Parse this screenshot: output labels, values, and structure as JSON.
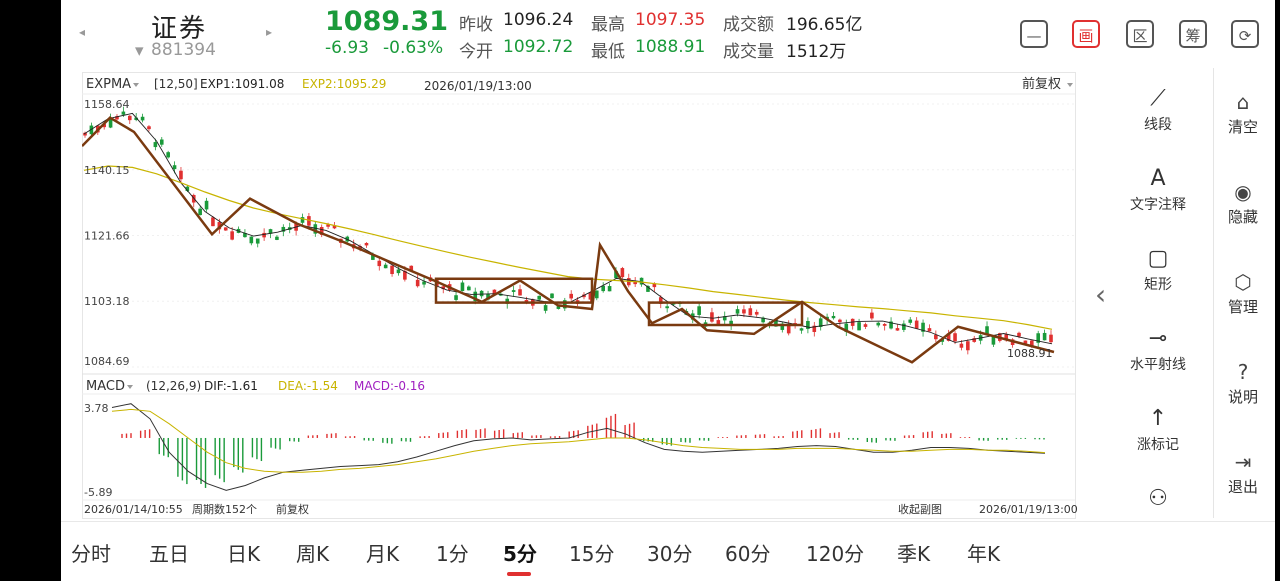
{
  "header": {
    "nav_prev": "◂",
    "nav_next": "▸",
    "name": "证券",
    "code_prefix": "▾",
    "code": "881394",
    "price": "1089.31",
    "change": "-6.93",
    "change_pct": "-0.63%",
    "stats": [
      {
        "label": "昨收",
        "value": "1096.24",
        "color": "normal"
      },
      {
        "label": "最高",
        "value": "1097.35",
        "color": "red"
      },
      {
        "label": "成交额",
        "value": "196.65亿",
        "color": "normal"
      },
      {
        "label": "今开",
        "value": "1092.72",
        "color": "green"
      },
      {
        "label": "最低",
        "value": "1088.91",
        "color": "green"
      },
      {
        "label": "成交量",
        "value": "1512万",
        "color": "normal"
      }
    ],
    "icons": [
      {
        "name": "minus-box-icon",
        "glyph": "—"
      },
      {
        "name": "draw-icon",
        "glyph": "画"
      },
      {
        "name": "section-icon",
        "glyph": "区"
      },
      {
        "name": "chip-icon",
        "glyph": "筹"
      },
      {
        "name": "rotate-screen-icon",
        "glyph": "⟳"
      }
    ]
  },
  "colors": {
    "up": "#e03030",
    "down": "#1a9a3a",
    "exp1": "#222222",
    "exp2": "#c8b400",
    "macd_pos": "#e03030",
    "macd_neg": "#1a9a3a",
    "drawing": "#7a3a10"
  },
  "indicator_main": {
    "name": "EXPMA",
    "params": "[12,50]",
    "exp1": "EXP1:1091.08",
    "exp2": "EXP2:1095.29",
    "datetime": "2026/01/19/13:00",
    "adjust": "前复权"
  },
  "indicator_sub": {
    "name": "MACD",
    "params": "(12,26,9)",
    "dif": "DIF:-1.61",
    "dea": "DEA:-1.54",
    "macd": "MACD:-0.16",
    "ymax": "3.78",
    "ymin": "-5.89"
  },
  "footer": {
    "start": "2026/01/14/10:55",
    "period": "周期数152个",
    "adjust": "前复权",
    "collapse": "收起副图",
    "end": "2026/01/19/13:00"
  },
  "price_tag": "1088.91",
  "side_tools": [
    {
      "name": "line-segment-tool",
      "icon": "⟋",
      "label": "线段"
    },
    {
      "name": "text-note-tool",
      "icon": "A",
      "label": "文字注释"
    },
    {
      "name": "rectangle-tool",
      "icon": "▢",
      "label": "矩形"
    },
    {
      "name": "horizontal-ray-tool",
      "icon": "⊸",
      "label": "水平射线"
    },
    {
      "name": "rise-mark-tool",
      "icon": "↑",
      "label": "涨标记"
    },
    {
      "name": "more-tool",
      "icon": "⚇",
      "label": ""
    }
  ],
  "side_actions": [
    {
      "name": "clear-action",
      "icon": "⌂",
      "label": "清空"
    },
    {
      "name": "hide-action",
      "icon": "◉",
      "label": "隐藏"
    },
    {
      "name": "manage-action",
      "icon": "⬡",
      "label": "管理"
    },
    {
      "name": "help-action",
      "icon": "?",
      "label": "说明"
    },
    {
      "name": "exit-action",
      "icon": "⇥",
      "label": "退出"
    }
  ],
  "collapse_arrow": "‹",
  "tabs": [
    {
      "label": "分时",
      "active": false
    },
    {
      "label": "五日",
      "active": false
    },
    {
      "label": "日K",
      "active": false
    },
    {
      "label": "周K",
      "active": false
    },
    {
      "label": "月K",
      "active": false
    },
    {
      "label": "1分",
      "active": false
    },
    {
      "label": "5分",
      "active": true
    },
    {
      "label": "15分",
      "active": false
    },
    {
      "label": "30分",
      "active": false
    },
    {
      "label": "60分",
      "active": false
    },
    {
      "label": "120分",
      "active": false
    },
    {
      "label": "季K",
      "active": false
    },
    {
      "label": "年K",
      "active": false
    }
  ],
  "chart_data": [
    {
      "type": "candlestick",
      "title": "EXPMA",
      "ylim": [
        1084.69,
        1158.64
      ],
      "yticks": [
        "1158.64",
        "1140.15",
        "1121.66",
        "1103.18",
        "1084.69"
      ],
      "x_start": "2026/01/14/10:55",
      "x_end": "2026/01/19/13:00",
      "periods": 152,
      "series": [
        {
          "name": "EXP1",
          "values": [
            1150.2,
            1154.5,
            1156.0,
            1148.2,
            1136.5,
            1128.4,
            1123.8,
            1121.5,
            1122.6,
            1124.5,
            1123.1,
            1120.2,
            1116.3,
            1112.4,
            1109.0,
            1106.3,
            1105.1,
            1105.3,
            1104.3,
            1103.1,
            1102.6,
            1106.0,
            1109.6,
            1108.7,
            1103.6,
            1099.0,
            1098.4,
            1099.3,
            1098.5,
            1097.2,
            1095.8,
            1096.8,
            1097.5,
            1097.6,
            1096.2,
            1094.4,
            1091.6,
            1092.8,
            1094.1,
            1092.6,
            1091.2
          ]
        },
        {
          "name": "EXP2",
          "values": [
            1140.0,
            1141.2,
            1140.8,
            1139.0,
            1136.5,
            1133.9,
            1131.5,
            1129.4,
            1127.8,
            1126.4,
            1125.0,
            1123.5,
            1121.9,
            1120.2,
            1118.6,
            1117.0,
            1115.5,
            1114.1,
            1112.7,
            1111.4,
            1110.1,
            1109.4,
            1109.0,
            1108.6,
            1107.8,
            1106.9,
            1105.9,
            1105.1,
            1104.3,
            1103.5,
            1102.8,
            1102.2,
            1101.6,
            1101.1,
            1100.5,
            1099.9,
            1099.1,
            1098.4,
            1097.7,
            1096.6,
            1095.3
          ]
        }
      ],
      "drawings": {
        "segments_y": [
          1146.8,
          1154.8,
          1150.8,
          1122.0,
          1132.0,
          1125.0,
          1120.0,
          1114.0,
          1109.0,
          1103.0,
          1109.0,
          1102.0,
          1101.0,
          1119.0,
          1106.0,
          1097.0,
          1101.0,
          1095.0,
          1094.0,
          1103.0,
          1096.0,
          1086.0,
          1096.0,
          1088.9
        ],
        "boxes": [
          {
            "y_top": 1109.5,
            "y_bottom": 1102.8
          },
          {
            "y_top": 1102.8,
            "y_bottom": 1096.5
          }
        ]
      }
    },
    {
      "type": "bar",
      "title": "MACD",
      "ylim": [
        -5.89,
        3.78
      ],
      "series": [
        {
          "name": "MACD",
          "values": [
            0.5,
            0.9,
            -2.0,
            -4.8,
            -5.2,
            -4.6,
            -3.6,
            -2.4,
            -1.2,
            -0.4,
            0.3,
            0.5,
            0.2,
            -0.3,
            -0.6,
            -0.4,
            0.2,
            0.6,
            0.9,
            1.0,
            0.9,
            0.6,
            0.3,
            0.2,
            0.8,
            1.5,
            2.5,
            1.6,
            -0.4,
            -0.8,
            -0.5,
            -0.3,
            0.1,
            0.3,
            0.4,
            0.2,
            0.8,
            1.0,
            0.6,
            -0.2,
            -0.5,
            -0.3,
            0.3,
            0.7,
            0.5,
            0.1,
            -0.3,
            -0.2,
            -0.1,
            -0.16
          ]
        },
        {
          "name": "DIF",
          "values": [
            3.2,
            3.6,
            2.0,
            -1.5,
            -3.5,
            -4.8,
            -5.5,
            -5.0,
            -4.2,
            -3.6,
            -3.4,
            -3.2,
            -3.0,
            -2.9,
            -2.8,
            -2.5,
            -2.0,
            -1.4,
            -0.8,
            -0.3,
            -0.1,
            0.0,
            -0.2,
            -0.1,
            0.0,
            0.6,
            1.0,
            0.4,
            -0.5,
            -1.2,
            -1.4,
            -1.5,
            -1.4,
            -1.3,
            -1.2,
            -1.1,
            -0.9,
            -0.8,
            -0.9,
            -1.2,
            -1.5,
            -1.5,
            -1.3,
            -1.0,
            -1.0,
            -1.1,
            -1.3,
            -1.4,
            -1.5,
            -1.61
          ]
        },
        {
          "name": "DEA",
          "values": [
            2.8,
            3.0,
            2.8,
            1.5,
            0.0,
            -1.5,
            -2.6,
            -3.2,
            -3.5,
            -3.6,
            -3.6,
            -3.5,
            -3.3,
            -3.2,
            -3.0,
            -2.8,
            -2.5,
            -2.2,
            -1.8,
            -1.4,
            -1.1,
            -0.8,
            -0.6,
            -0.5,
            -0.4,
            -0.2,
            0.0,
            0.0,
            -0.2,
            -0.5,
            -0.8,
            -1.0,
            -1.1,
            -1.2,
            -1.2,
            -1.2,
            -1.1,
            -1.1,
            -1.1,
            -1.2,
            -1.3,
            -1.4,
            -1.4,
            -1.3,
            -1.2,
            -1.2,
            -1.3,
            -1.3,
            -1.4,
            -1.54
          ]
        }
      ]
    }
  ]
}
